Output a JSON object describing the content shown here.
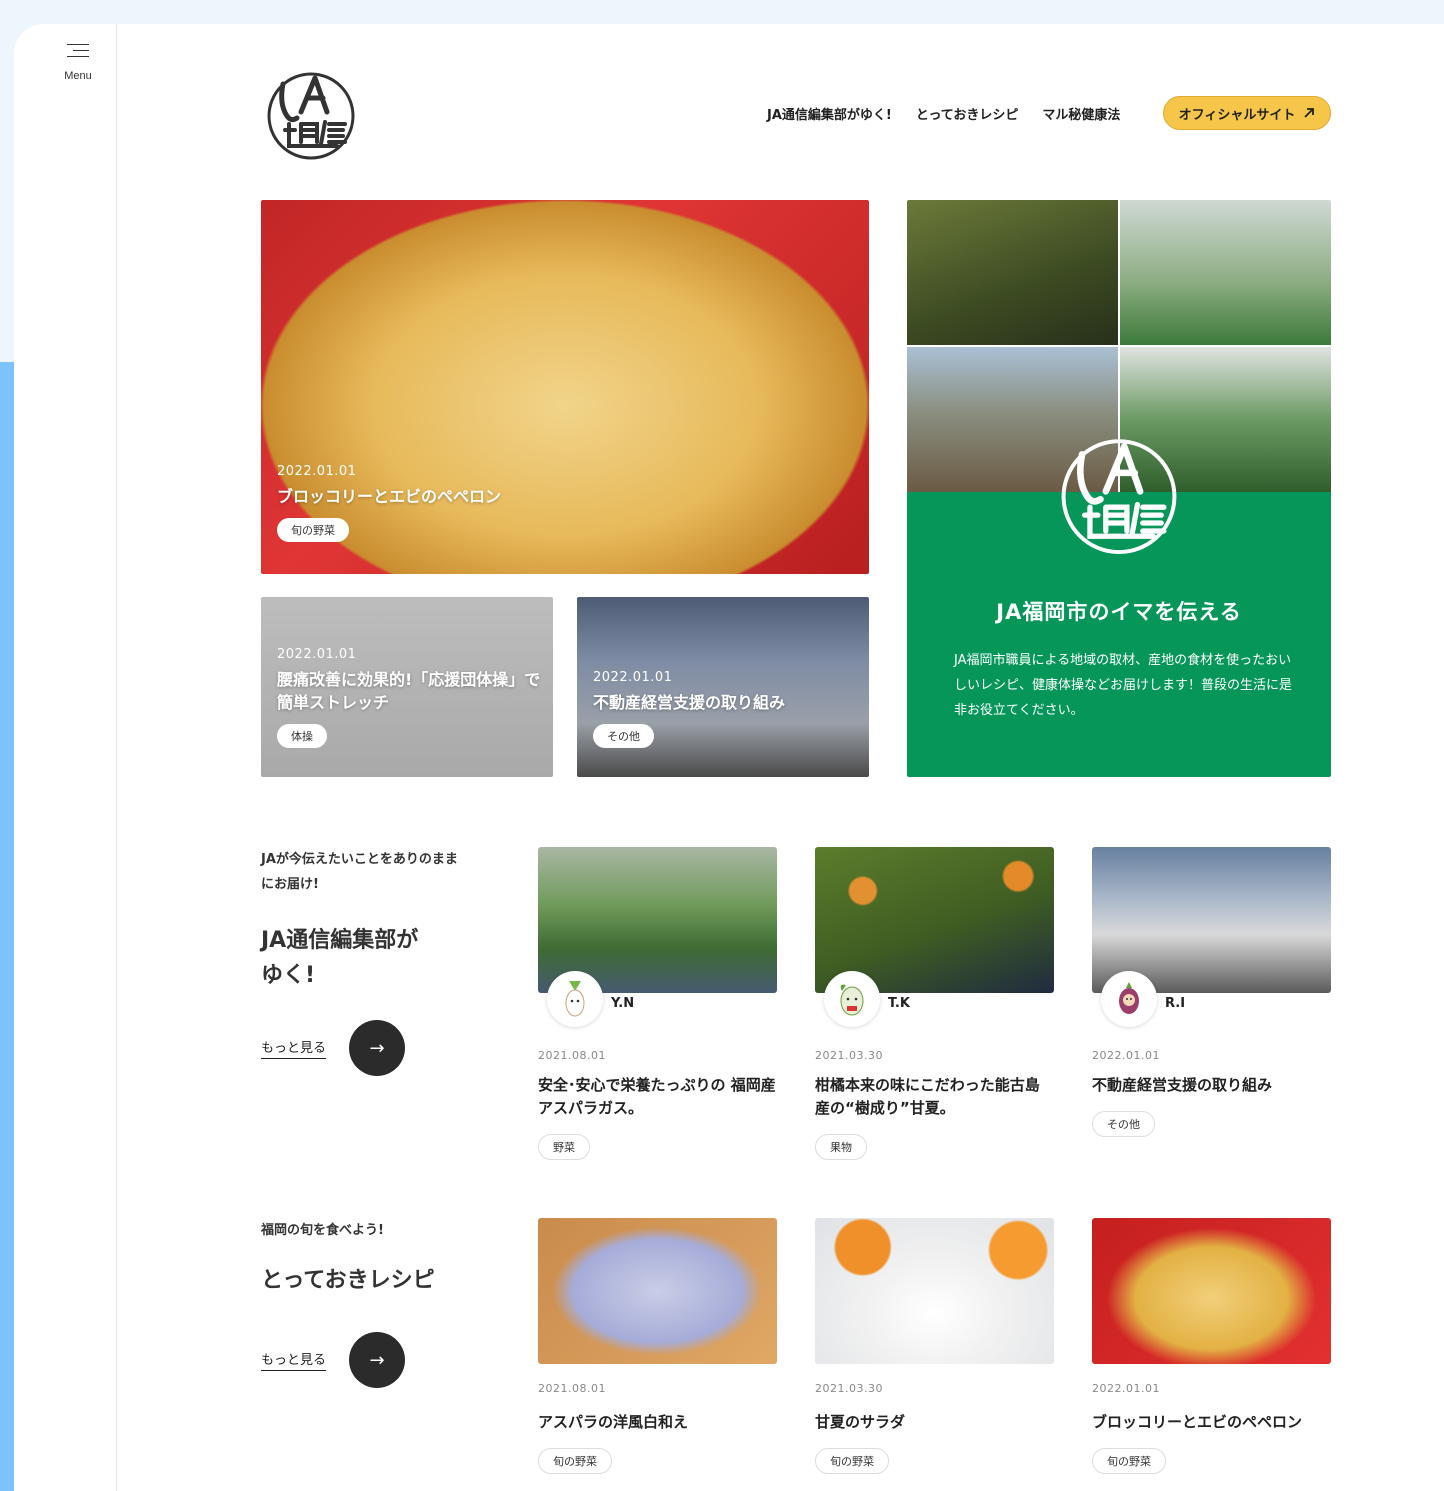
{
  "sidebar": {
    "menu_label": "Menu"
  },
  "header": {
    "nav": [
      "JA通信編集部がゆく!",
      "とっておきレシピ",
      "マル秘健康法"
    ],
    "official_label": "オフィシャルサイト",
    "official_icon": "arrow-up-right-icon"
  },
  "hero": {
    "main": {
      "date": "2022.01.01",
      "title": "ブロッコリーとエビのペペロン",
      "tag": "旬の野菜"
    },
    "small": [
      {
        "date": "2022.01.01",
        "title": "腰痛改善に効果的!「応援団体操」で簡単ストレッチ",
        "tag": "体操"
      },
      {
        "date": "2022.01.01",
        "title": "不動産経営支援の取り組み",
        "tag": "その他"
      }
    ],
    "panel": {
      "heading": "JA福岡市のイマを伝える",
      "desc": "JA福岡市職員による地域の取材、産地の食材を使ったおいしいレシピ、健康体操などお届けします！普段の生活に是非お役立てください。",
      "brand_color": "#06965a"
    }
  },
  "sections": {
    "editorial": {
      "lead": "JAが今伝えたいことをありのままにお届け!",
      "title": "JA通信編集部がゆく!",
      "more_label": "もっと見る",
      "articles": [
        {
          "author": "Y.N",
          "date": "2021.08.01",
          "title": "安全･安心で栄養たっぷりの 福岡産アスパラガス。",
          "tag": "野菜"
        },
        {
          "author": "T.K",
          "date": "2021.03.30",
          "title": "柑橘本来の味にこだわった能古島産の“樹成り”甘夏。",
          "tag": "果物"
        },
        {
          "author": "R.I",
          "date": "2022.01.01",
          "title": "不動産経営支援の取り組み",
          "tag": "その他"
        }
      ]
    },
    "recipes": {
      "lead": "福岡の旬を食べよう!",
      "title": "とっておきレシピ",
      "more_label": "もっと見る",
      "articles": [
        {
          "date": "2021.08.01",
          "title": "アスパラの洋風白和え",
          "tag": "旬の野菜"
        },
        {
          "date": "2021.03.30",
          "title": "甘夏のサラダ",
          "tag": "旬の野菜"
        },
        {
          "date": "2022.01.01",
          "title": "ブロッコリーとエビのペペロン",
          "tag": "旬の野菜"
        }
      ]
    }
  },
  "colors": {
    "accent_yellow": "#f6c64a",
    "side_blue": "#7cc2ff",
    "dark_button": "#2b2b2b"
  }
}
